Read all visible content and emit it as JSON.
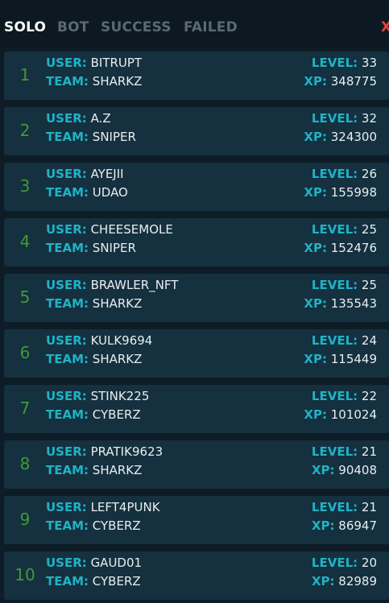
{
  "tabs": {
    "solo": "SOLO",
    "bot": "BOT",
    "success": "SUCCESS",
    "failed": "FAILED",
    "close": "X"
  },
  "labels": {
    "user": "USER:",
    "team": "TEAM:",
    "level": "LEVEL:",
    "xp": "XP:"
  },
  "leaderboard": [
    {
      "rank": "1",
      "user": "BITRUPT",
      "team": "SHARKZ",
      "level": "33",
      "xp": "348775"
    },
    {
      "rank": "2",
      "user": "A.Z",
      "team": "SNIPER",
      "level": "32",
      "xp": "324300"
    },
    {
      "rank": "3",
      "user": "AYEJII",
      "team": "UDAO",
      "level": "26",
      "xp": "155998"
    },
    {
      "rank": "4",
      "user": "CHEESEMOLE",
      "team": "SNIPER",
      "level": "25",
      "xp": "152476"
    },
    {
      "rank": "5",
      "user": "BRAWLER_NFT",
      "team": "SHARKZ",
      "level": "25",
      "xp": "135543"
    },
    {
      "rank": "6",
      "user": "KULK9694",
      "team": "SHARKZ",
      "level": "24",
      "xp": "115449"
    },
    {
      "rank": "7",
      "user": "STINK225",
      "team": "CYBERZ",
      "level": "22",
      "xp": "101024"
    },
    {
      "rank": "8",
      "user": "PRATIK9623",
      "team": "SHARKZ",
      "level": "21",
      "xp": "90408"
    },
    {
      "rank": "9",
      "user": "LEFT4PUNK",
      "team": "CYBERZ",
      "level": "21",
      "xp": "86947"
    },
    {
      "rank": "10",
      "user": "GAUD01",
      "team": "CYBERZ",
      "level": "20",
      "xp": "82989"
    }
  ]
}
